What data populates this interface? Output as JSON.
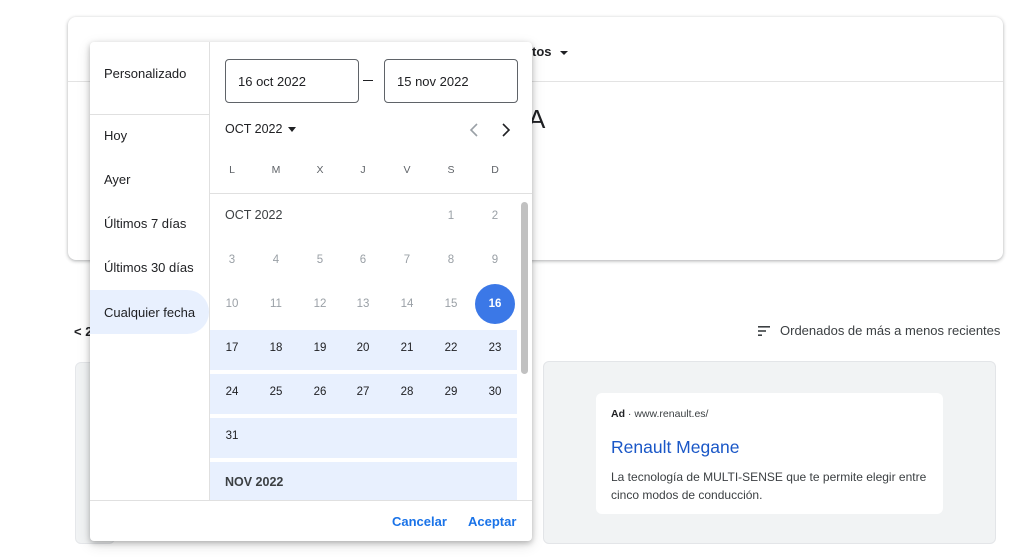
{
  "background": {
    "filter_fragment": "tos",
    "title_fragment": "A",
    "prev_fragment": "< 2",
    "sort_label": "Ordenados de más a menos recientes"
  },
  "ad": {
    "label": "Ad",
    "separator": "·",
    "url": "www.renault.es/",
    "title": "Renault Megane",
    "description": "La tecnología de MULTI-SENSE que te permite elegir entre cinco modos de conducción."
  },
  "picker": {
    "presets": [
      "Personalizado",
      "Hoy",
      "Ayer",
      "Últimos 7 días",
      "Últimos 30 días",
      "Cualquier fecha"
    ],
    "active_preset": "Cualquier fecha",
    "start_date": "16 oct 2022",
    "end_date": "15 nov 2022",
    "month_selector": "OCT 2022",
    "weekdays": [
      "L",
      "M",
      "X",
      "J",
      "V",
      "S",
      "D"
    ],
    "months": [
      {
        "label": "OCT 2022",
        "weeks": [
          [
            "",
            "",
            "",
            "",
            "",
            "1",
            "2"
          ],
          [
            "3",
            "4",
            "5",
            "6",
            "7",
            "8",
            "9"
          ],
          [
            "10",
            "11",
            "12",
            "13",
            "14",
            "15",
            "16"
          ],
          [
            "17",
            "18",
            "19",
            "20",
            "21",
            "22",
            "23"
          ],
          [
            "24",
            "25",
            "26",
            "27",
            "28",
            "29",
            "30"
          ],
          [
            "31",
            "",
            "",
            "",
            "",
            "",
            ""
          ]
        ]
      },
      {
        "label": "NOV 2022",
        "weeks": []
      }
    ],
    "selected_day": "16",
    "cancel_label": "Cancelar",
    "accept_label": "Aceptar"
  },
  "colors": {
    "accent": "#1a73e8",
    "selected": "#3b78e7",
    "range": "#e8f0fe",
    "ad_title": "#1a57c7"
  }
}
